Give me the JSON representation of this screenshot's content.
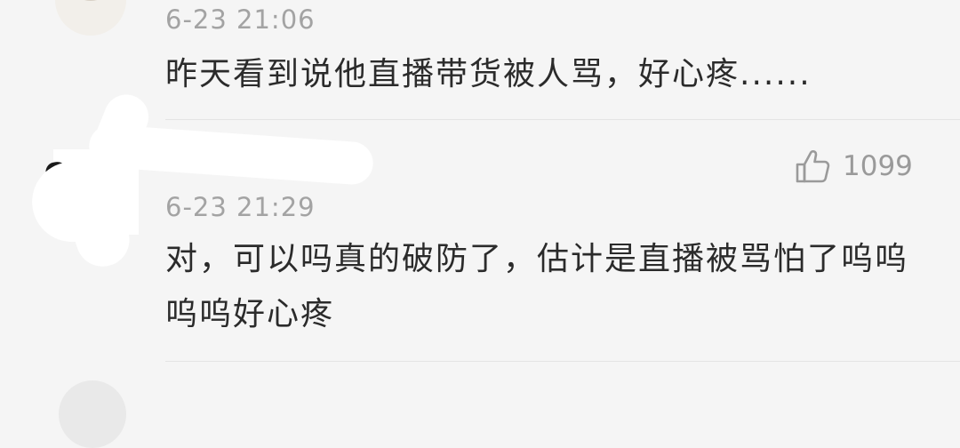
{
  "comments": [
    {
      "timestamp": "6-23 21:06",
      "text": "昨天看到说他直播带货被人骂，好心疼......"
    },
    {
      "timestamp": "6-23 21:29",
      "text": "对，可以吗真的破防了，估计是直播被骂怕了呜呜呜呜好心疼",
      "likes": "1099",
      "like_icon": "thumbs-up-icon"
    }
  ],
  "colors": {
    "background": "#f5f5f5",
    "timestamp": "#a3a3a3",
    "comment_text": "#2b2b2b",
    "like": "#9a9a9a",
    "divider": "#e4e4e4"
  }
}
